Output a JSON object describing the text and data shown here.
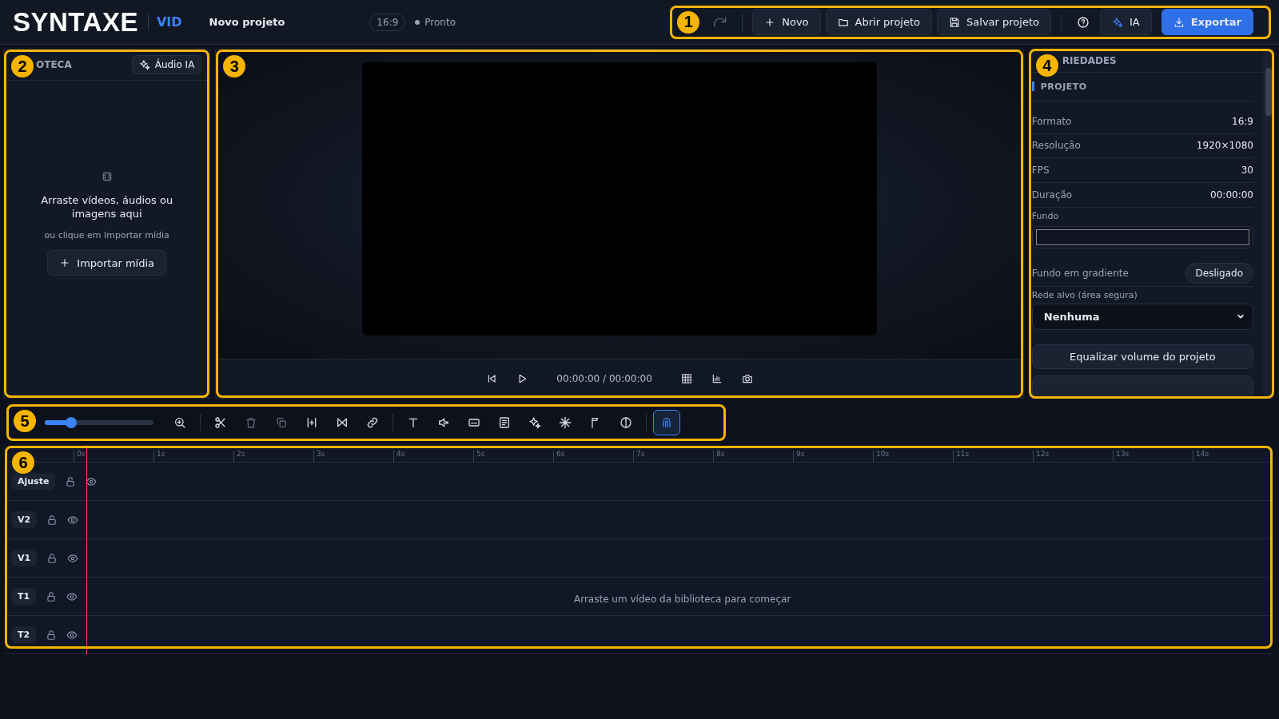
{
  "header": {
    "logo": "SYNTAXE",
    "logo_suffix": "VID",
    "project_name": "Novo projeto",
    "aspect": "16:9",
    "status": "Pronto",
    "actions": [
      {
        "kind": "redo",
        "disabled": true
      },
      {
        "kind": "new",
        "label": "Novo"
      },
      {
        "kind": "open",
        "label": "Abrir projeto"
      },
      {
        "kind": "save",
        "label": "Salvar projeto"
      },
      {
        "kind": "help"
      },
      {
        "kind": "ai",
        "label": "IA"
      },
      {
        "kind": "export",
        "label": "Exportar"
      }
    ]
  },
  "callouts": [
    {
      "number": "1"
    },
    {
      "number": "2"
    },
    {
      "number": "3"
    },
    {
      "number": "4"
    },
    {
      "number": "5"
    },
    {
      "number": "6"
    }
  ],
  "library": {
    "title": "OTECA",
    "ai_button": "Áudio IA",
    "empty_title": "Arraste vídeos, áudios ou imagens aqui",
    "empty_hint": "ou clique em Importar mídia",
    "import_button": "Importar mídia"
  },
  "preview": {
    "time": "00:00:00 / 00:00:00"
  },
  "properties": {
    "title": "RIEDADES",
    "section": "PROJETO",
    "rows": [
      {
        "label": "Formato",
        "value": "16:9"
      },
      {
        "label": "Resolução",
        "value": "1920×1080"
      },
      {
        "label": "FPS",
        "value": "30"
      },
      {
        "label": "Duração",
        "value": "00:00:00"
      }
    ],
    "background_label": "Fundo",
    "gradient_label": "Fundo em gradiente",
    "gradient_toggle": {
      "label": "Desligado",
      "on": false
    },
    "grid_label": "Rede alvo (área segura)",
    "grid_value": "Nenhuma",
    "equalize_button": "Equalizar volume do projeto"
  },
  "toolbar": {
    "zoom": {
      "level": 0.24
    },
    "tools": [
      {
        "kind": "zoom-in",
        "disabled": false,
        "selected": false
      },
      {
        "kind": "divider"
      },
      {
        "kind": "scissors",
        "disabled": false,
        "selected": false
      },
      {
        "kind": "trash",
        "disabled": true,
        "selected": false
      },
      {
        "kind": "copy",
        "disabled": true,
        "selected": false
      },
      {
        "kind": "split",
        "disabled": false,
        "selected": false
      },
      {
        "kind": "transition",
        "disabled": false,
        "selected": false
      },
      {
        "kind": "link",
        "disabled": false,
        "selected": false
      },
      {
        "kind": "divider"
      },
      {
        "kind": "text",
        "disabled": false,
        "selected": false
      },
      {
        "kind": "mute",
        "disabled": false,
        "selected": false
      },
      {
        "kind": "caption",
        "disabled": false,
        "selected": false
      },
      {
        "kind": "document",
        "disabled": false,
        "selected": false
      },
      {
        "kind": "sparkle",
        "disabled": false,
        "selected": false
      },
      {
        "kind": "burst",
        "disabled": false,
        "selected": false
      },
      {
        "kind": "flag",
        "disabled": false,
        "selected": false
      },
      {
        "kind": "contrast",
        "disabled": false,
        "selected": false
      },
      {
        "kind": "divider"
      },
      {
        "kind": "magnet",
        "disabled": false,
        "selected": true
      }
    ]
  },
  "timeline": {
    "ticks": [
      "0s",
      "1s",
      "2s",
      "3s",
      "4s",
      "5s",
      "6s",
      "7s",
      "8s",
      "9s",
      "10s",
      "11s",
      "12s",
      "13s",
      "14s"
    ],
    "tracks": [
      {
        "name": "Ajuste"
      },
      {
        "name": "V2"
      },
      {
        "name": "V1"
      },
      {
        "name": "T1"
      },
      {
        "name": "T2"
      }
    ],
    "empty_hint": "Arraste um vídeo da biblioteca para começar"
  }
}
